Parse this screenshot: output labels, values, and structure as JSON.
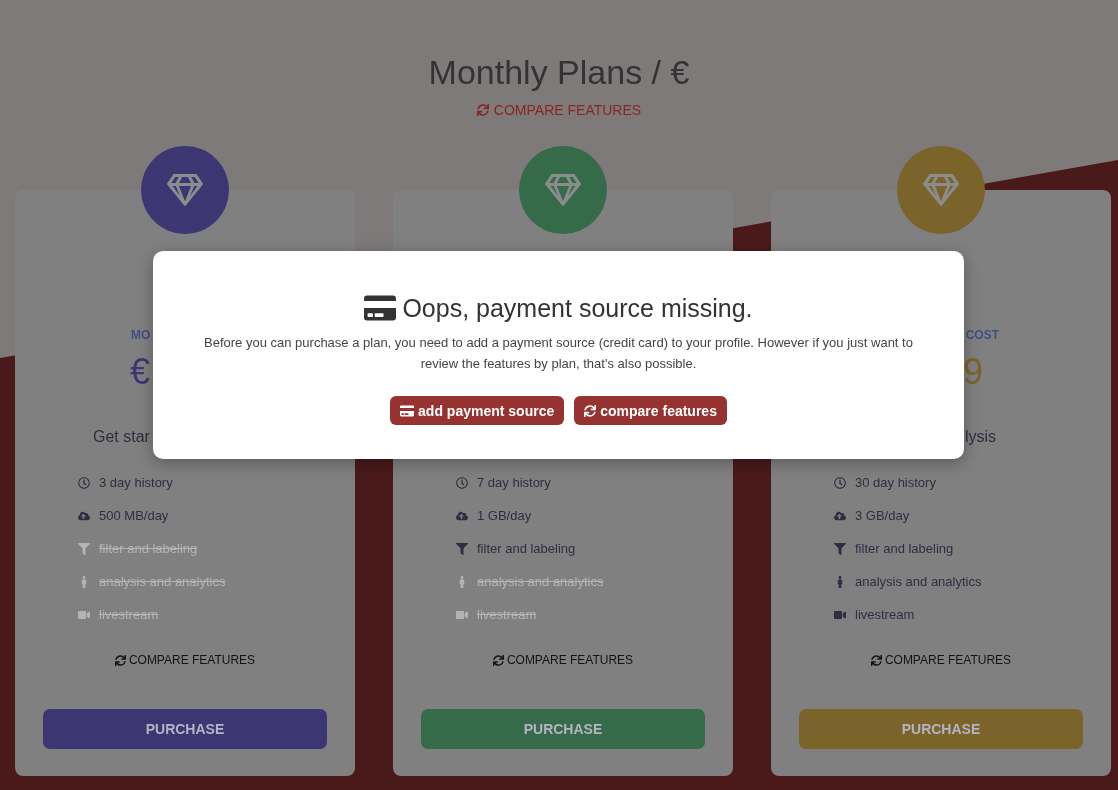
{
  "page": {
    "title": "Monthly Plans / €",
    "compare_link": "COMPARE FEATURES"
  },
  "plans": [
    {
      "color": "#3c3673",
      "plan_type": "MO",
      "price": "€",
      "tagline": "Get star",
      "features": [
        {
          "kind": "history",
          "label": "3 day history",
          "included": true
        },
        {
          "kind": "bandwidth",
          "label": "500 MB/day",
          "included": true
        },
        {
          "kind": "filter",
          "label": "filter and labeling",
          "included": false
        },
        {
          "kind": "analysis",
          "label": "analysis and analytics",
          "included": false
        },
        {
          "kind": "livestream",
          "label": "livestream",
          "included": false
        }
      ],
      "compare_link": "COMPARE FEATURES",
      "button": "PURCHASE"
    },
    {
      "color": "#356b48",
      "features": [
        {
          "kind": "history",
          "label": "7 day history",
          "included": true
        },
        {
          "kind": "bandwidth",
          "label": "1 GB/day",
          "included": true
        },
        {
          "kind": "filter",
          "label": "filter and labeling",
          "included": true
        },
        {
          "kind": "analysis",
          "label": "analysis and analytics",
          "included": false
        },
        {
          "kind": "livestream",
          "label": "livestream",
          "included": false
        }
      ],
      "compare_link": "COMPARE FEATURES",
      "button": "PURCHASE"
    },
    {
      "color": "#7a6429",
      "plan_type": "COST",
      "price": "9",
      "tagline": "lysis",
      "features": [
        {
          "kind": "history",
          "label": "30 day history",
          "included": true
        },
        {
          "kind": "bandwidth",
          "label": "3 GB/day",
          "included": true
        },
        {
          "kind": "filter",
          "label": "filter and labeling",
          "included": true
        },
        {
          "kind": "analysis",
          "label": "analysis and analytics",
          "included": true
        },
        {
          "kind": "livestream",
          "label": "livestream",
          "included": true
        }
      ],
      "compare_link": "COMPARE FEATURES",
      "button": "PURCHASE"
    }
  ],
  "modal": {
    "title": "Oops, payment source missing.",
    "message": "Before you can purchase a plan, you need to add a payment source (credit card) to your profile. However if you just want to review the features by plan, that's also possible.",
    "buttons": [
      {
        "kind": "card",
        "label": "add payment source"
      },
      {
        "kind": "sync",
        "label": "compare features"
      }
    ]
  }
}
